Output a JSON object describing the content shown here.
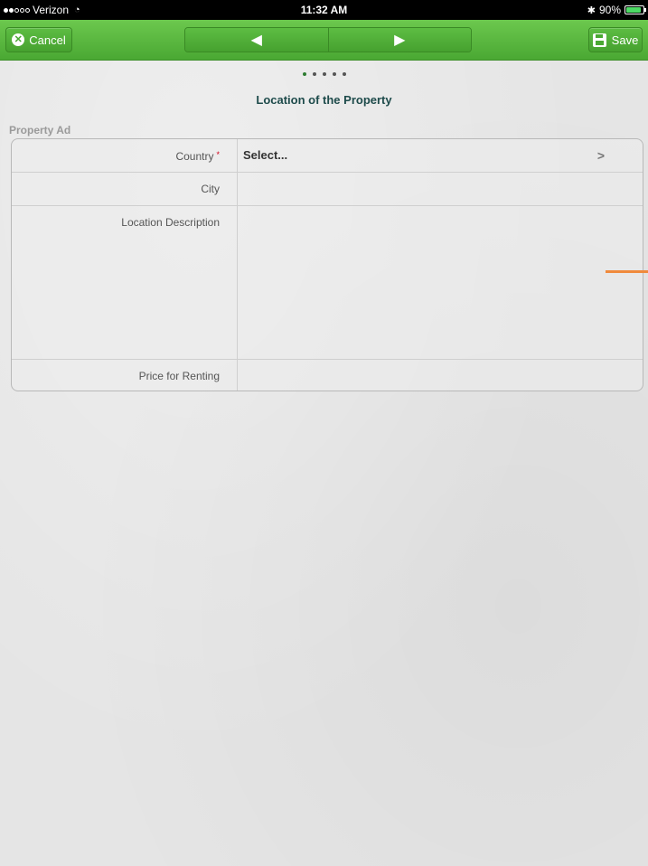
{
  "status_bar": {
    "carrier": "Verizon",
    "time": "11:32 AM",
    "battery": "90%",
    "battery_level": 0.9,
    "signal_bars": 2,
    "signal_total": 5
  },
  "toolbar": {
    "cancel_label": "Cancel",
    "save_label": "Save",
    "prev_icon": "arrow-left-icon",
    "next_icon": "arrow-right-icon"
  },
  "wizard": {
    "step_count": 5,
    "current_step": 1,
    "title": "Location of the Property"
  },
  "form": {
    "section_label": "Property Ad",
    "fields": [
      {
        "label": "Country",
        "required": true,
        "value": "Select..."
      },
      {
        "label": "City",
        "required": false,
        "value": ""
      },
      {
        "label": "Location Description",
        "required": false,
        "value": ""
      },
      {
        "label": "Price for Renting",
        "required": false,
        "value": ""
      }
    ],
    "required_marker": "*"
  },
  "colors": {
    "toolbar_green": "#4aa833",
    "required_red": "#d0021b",
    "title_color": "#1e4b4b",
    "active_dot": "#2e7d32",
    "accent_orange": "#f08a3c"
  }
}
